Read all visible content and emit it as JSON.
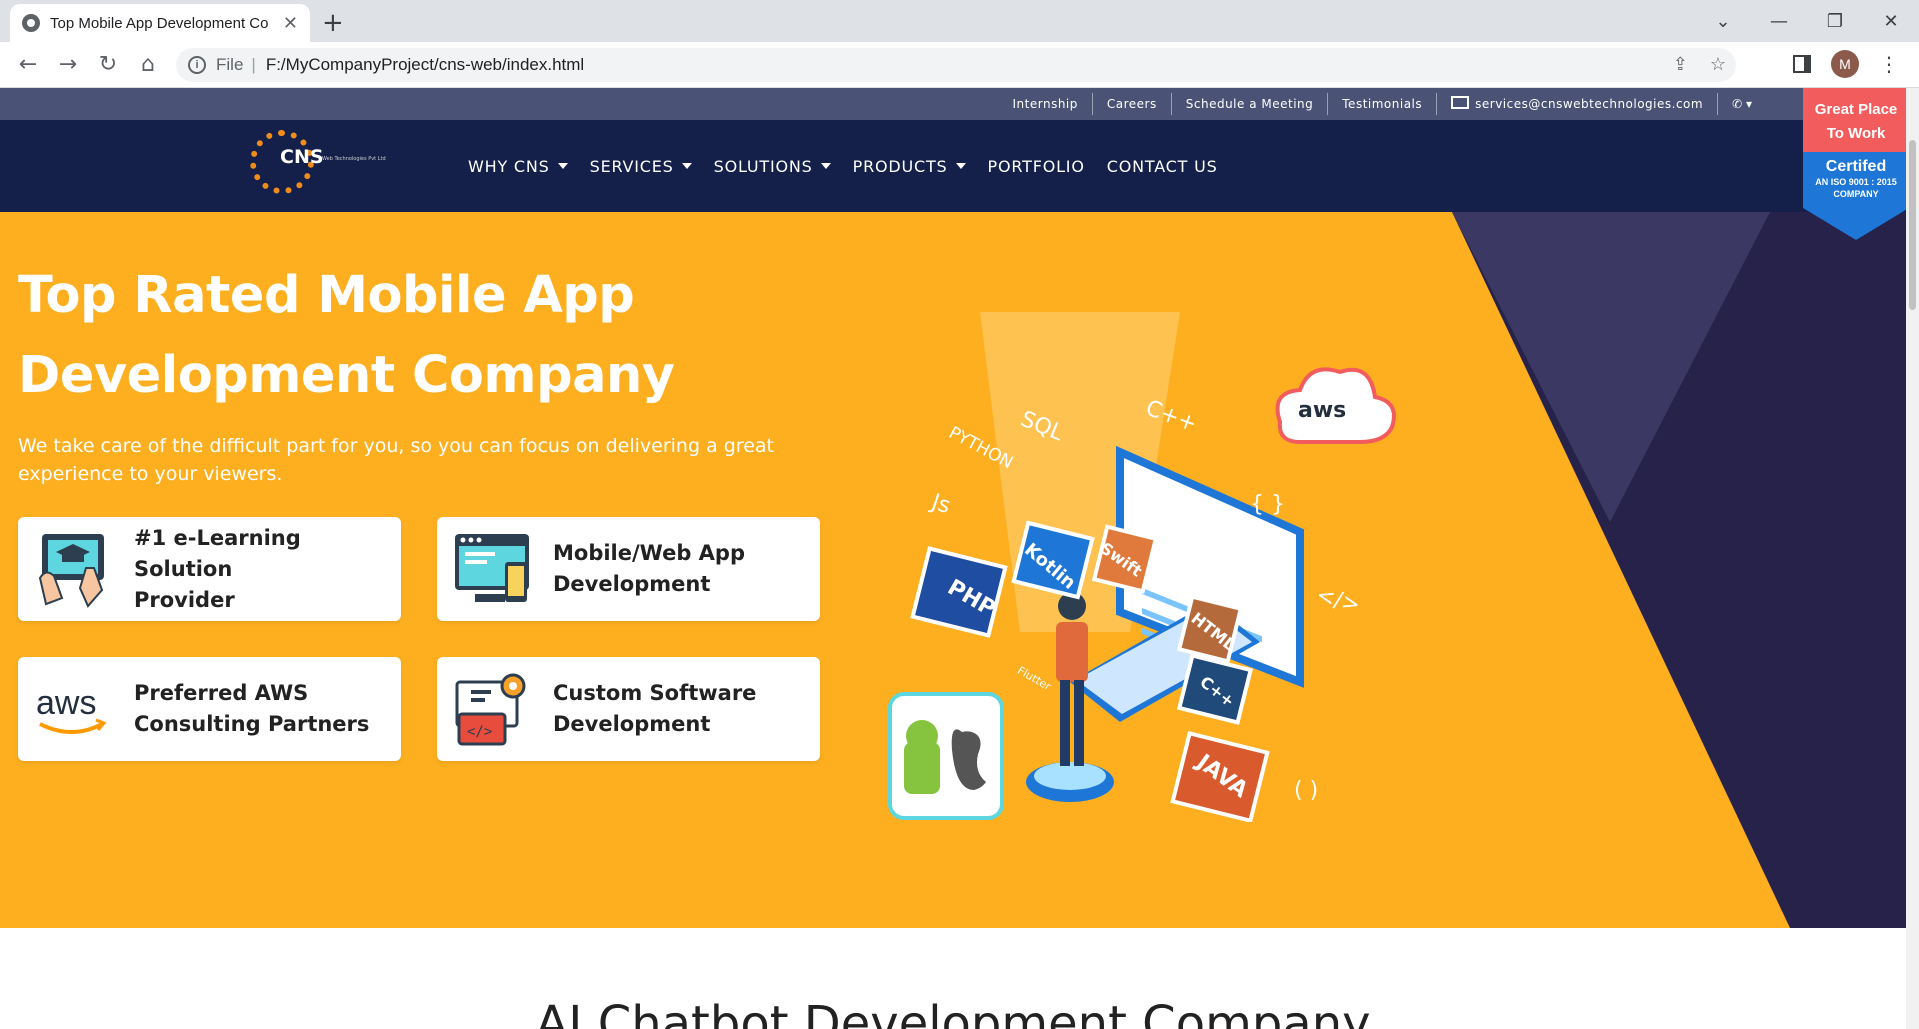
{
  "browser": {
    "tab_title": "Top Mobile App Development Co",
    "url_scheme": "File",
    "url": "F:/MyCompanyProject/cns-web/index.html",
    "profile_initial": "M"
  },
  "topbar": {
    "links": [
      "Internship",
      "Careers",
      "Schedule a Meeting",
      "Testimonials"
    ],
    "email": "services@cnswebtechnologies.com"
  },
  "logo": {
    "text": "CNS",
    "subtext": "Web Technologies Pvt Ltd"
  },
  "nav": {
    "items": [
      {
        "label": "WHY CNS",
        "dropdown": true
      },
      {
        "label": "SERVICES",
        "dropdown": true
      },
      {
        "label": "SOLUTIONS",
        "dropdown": true
      },
      {
        "label": "PRODUCTS",
        "dropdown": true
      },
      {
        "label": "PORTFOLIO",
        "dropdown": false
      },
      {
        "label": "CONTACT US",
        "dropdown": false
      }
    ]
  },
  "badge": {
    "line1": "Great Place",
    "line2": "To Work",
    "certified": "Certifed",
    "iso1": "AN ISO 9001 : 2015",
    "iso2": "COMPANY"
  },
  "hero": {
    "title_line1": "Top Rated Mobile App",
    "title_line2": "Development Company",
    "lead": "We take care of the difficult part for you, so you can focus on delivering a great experience to your viewers.",
    "cards": [
      {
        "line1": "#1 e-Learning Solution",
        "line2": "Provider",
        "icon": "elearning-icon"
      },
      {
        "line1": "Mobile/Web App",
        "line2": "Development",
        "icon": "monitor-icon"
      },
      {
        "line1": "Preferred AWS",
        "line2": "Consulting Partners",
        "icon": "aws-icon"
      },
      {
        "line1": "Custom Software",
        "line2": "Development",
        "icon": "code-window-icon"
      }
    ],
    "aws_logo_text": "aws",
    "illustration_labels": [
      "PYTHON",
      "SQL",
      "C++",
      "Js",
      "PHP",
      "Kotlin",
      "Swift",
      "HTML",
      "C++",
      "JAVA",
      "Flutter",
      "{ }",
      "</>",
      "( )"
    ]
  },
  "next_section": {
    "title": "AI Chatbot Development Company"
  },
  "colors": {
    "hero_bg": "#fdaf20",
    "nav_bg": "#14204a",
    "topbar_bg": "#4a5276",
    "badge_red": "#f25c5c",
    "badge_blue": "#1e77d6"
  }
}
